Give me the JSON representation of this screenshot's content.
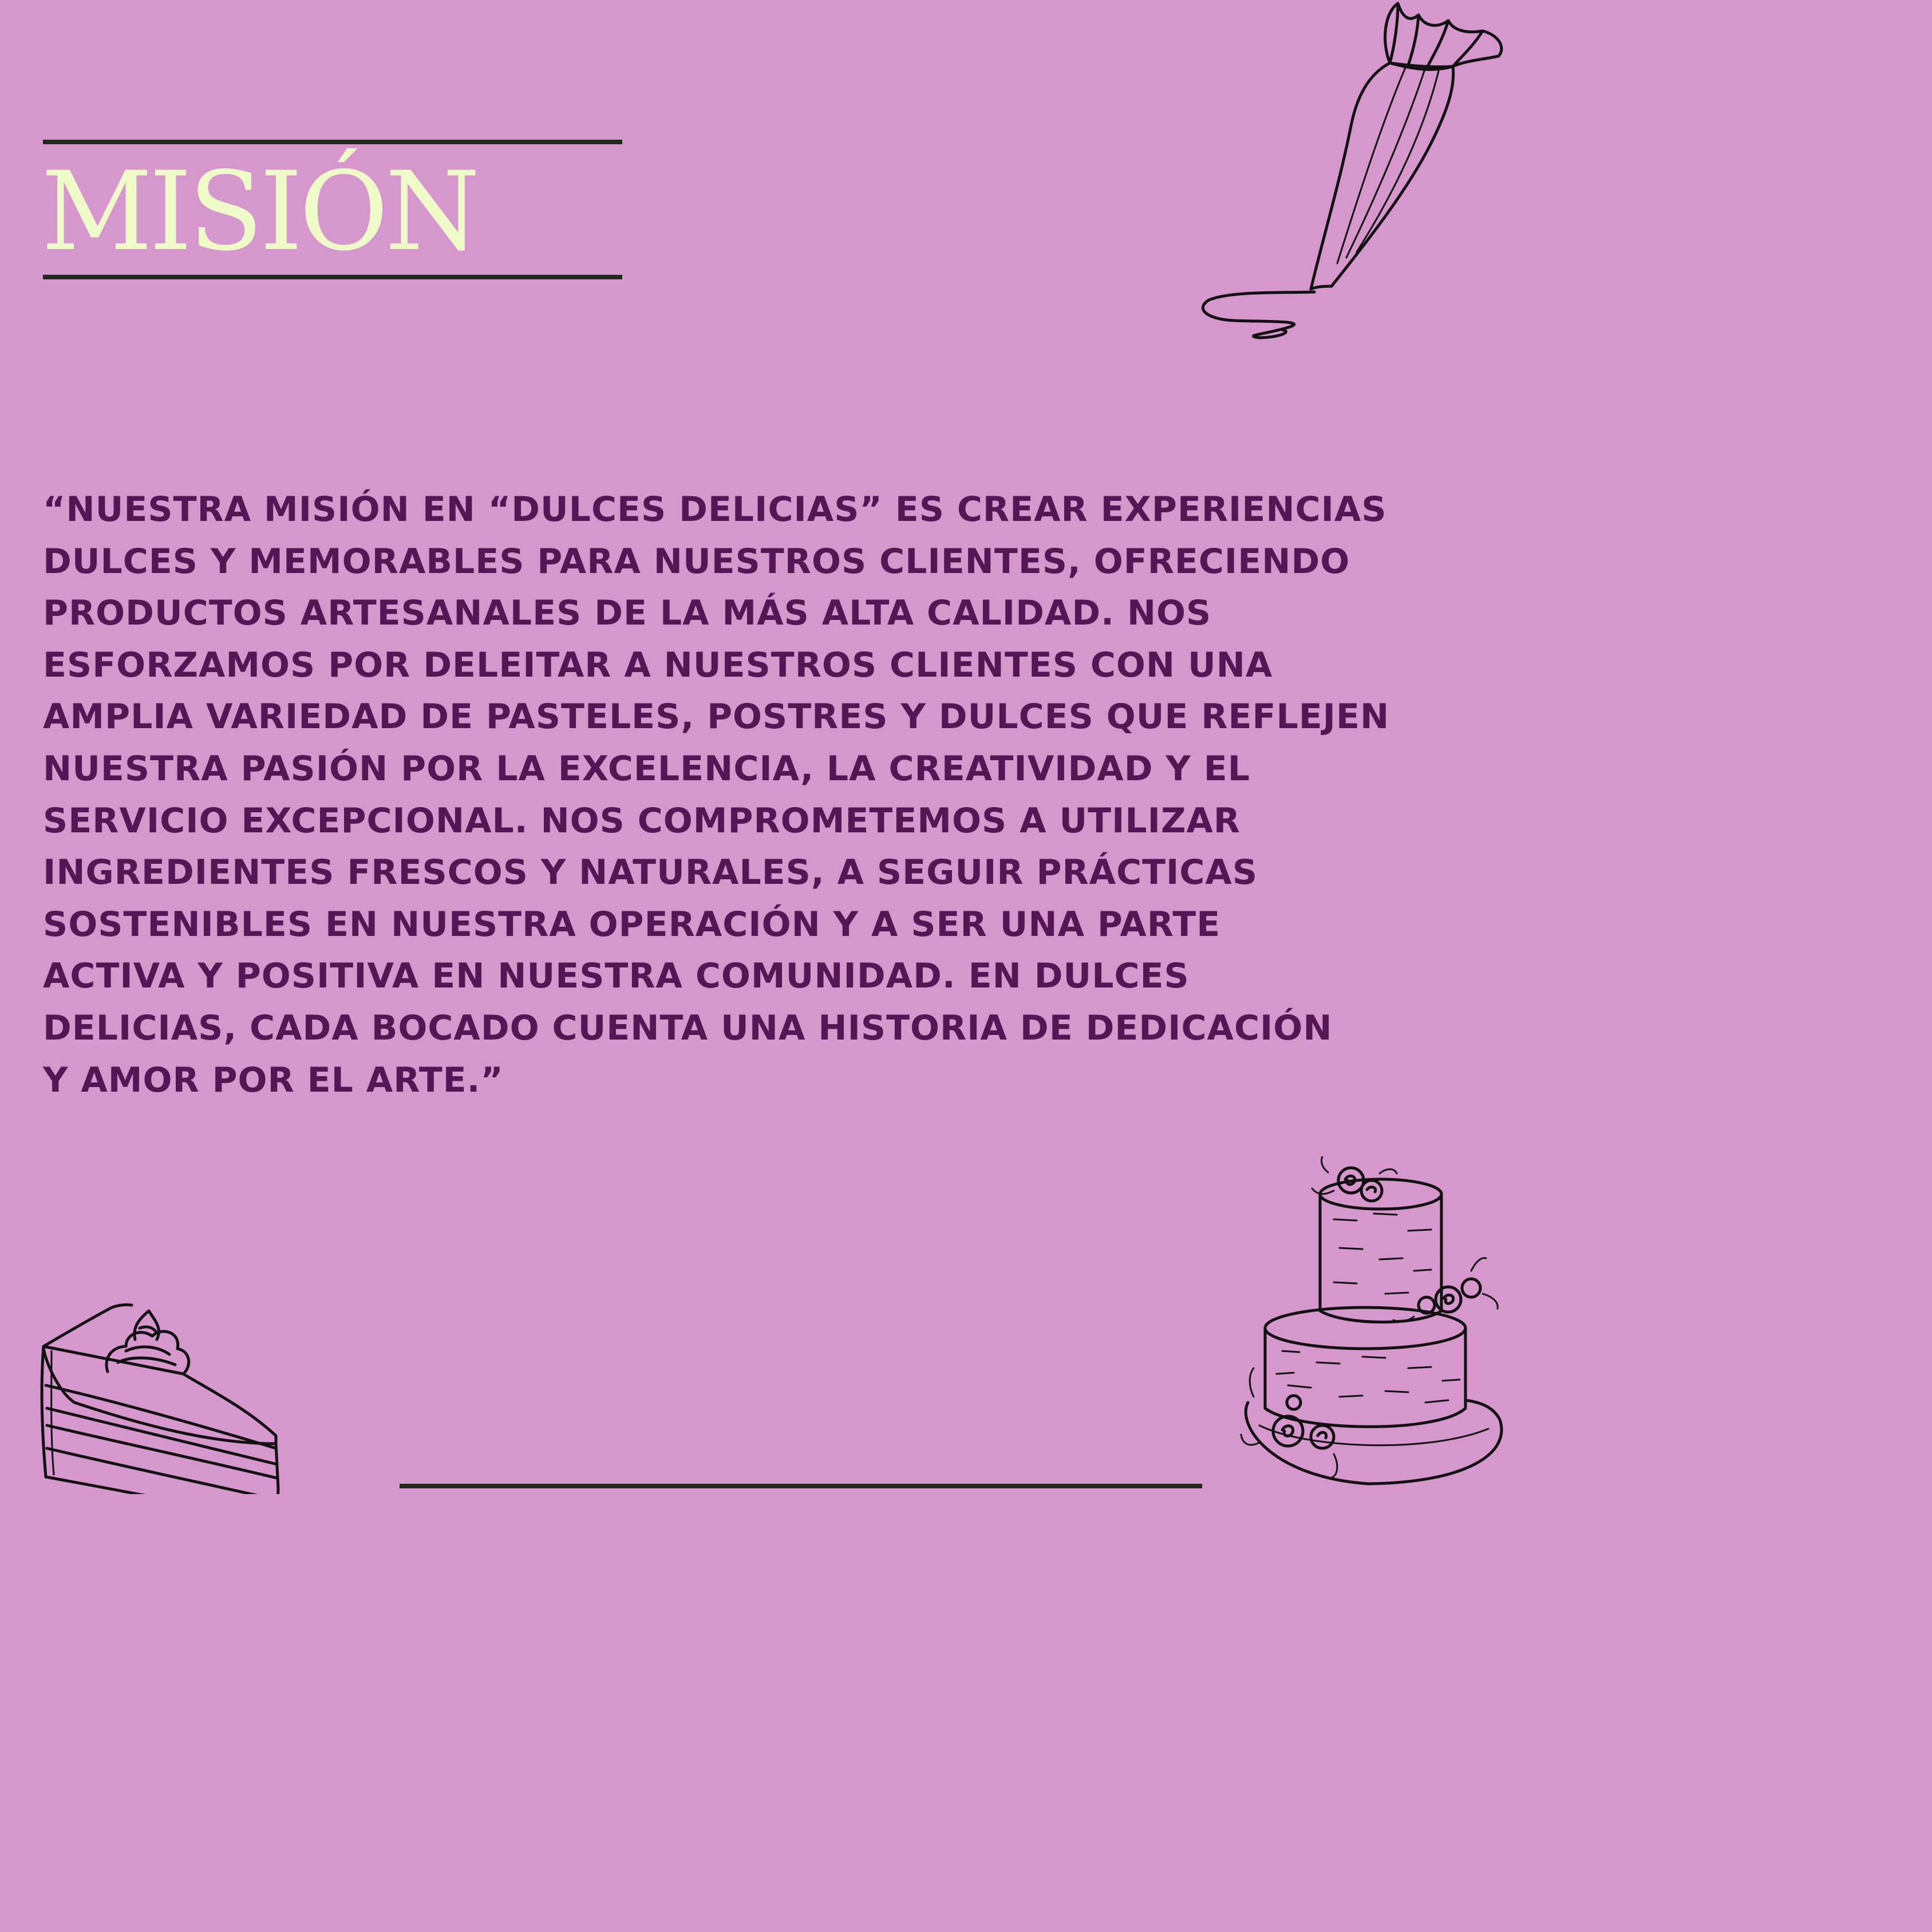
{
  "page": {
    "background_color": "#D597CC",
    "title_color": "#EFFAC9",
    "text_color": "#561555",
    "rule_color": "#1F2A1C"
  },
  "header": {
    "title": "MISIÓN"
  },
  "mission": {
    "lines": [
      "“Nuestra Misión en “Dulces Delicias” es crear experiencias",
      "dulces y memorables para nuestros clientes, ofreciendo",
      "productos artesanales de la más alta calidad. Nos",
      "esforzamos por deleitar a nuestros clientes con una",
      "amplia variedad de pasteles, postres y dulces que reflejen",
      "nuestra pasión por la excelencia, la creatividad y el",
      "servicio excepcional. Nos comprometemos a utilizar",
      "ingredientes frescos y naturales, a seguir prácticas",
      "sostenibles en nuestra operación y a ser una parte",
      "activa y positiva en nuestra comunidad. En Dulces",
      "Delicias, cada bocado cuenta una historia de dedicación",
      "y amor por el arte.”"
    ]
  },
  "illustrations": {
    "piping_bag": "piping-bag-icon",
    "cake_slice": "cake-slice-icon",
    "tiered_cake": "tiered-cake-icon"
  }
}
